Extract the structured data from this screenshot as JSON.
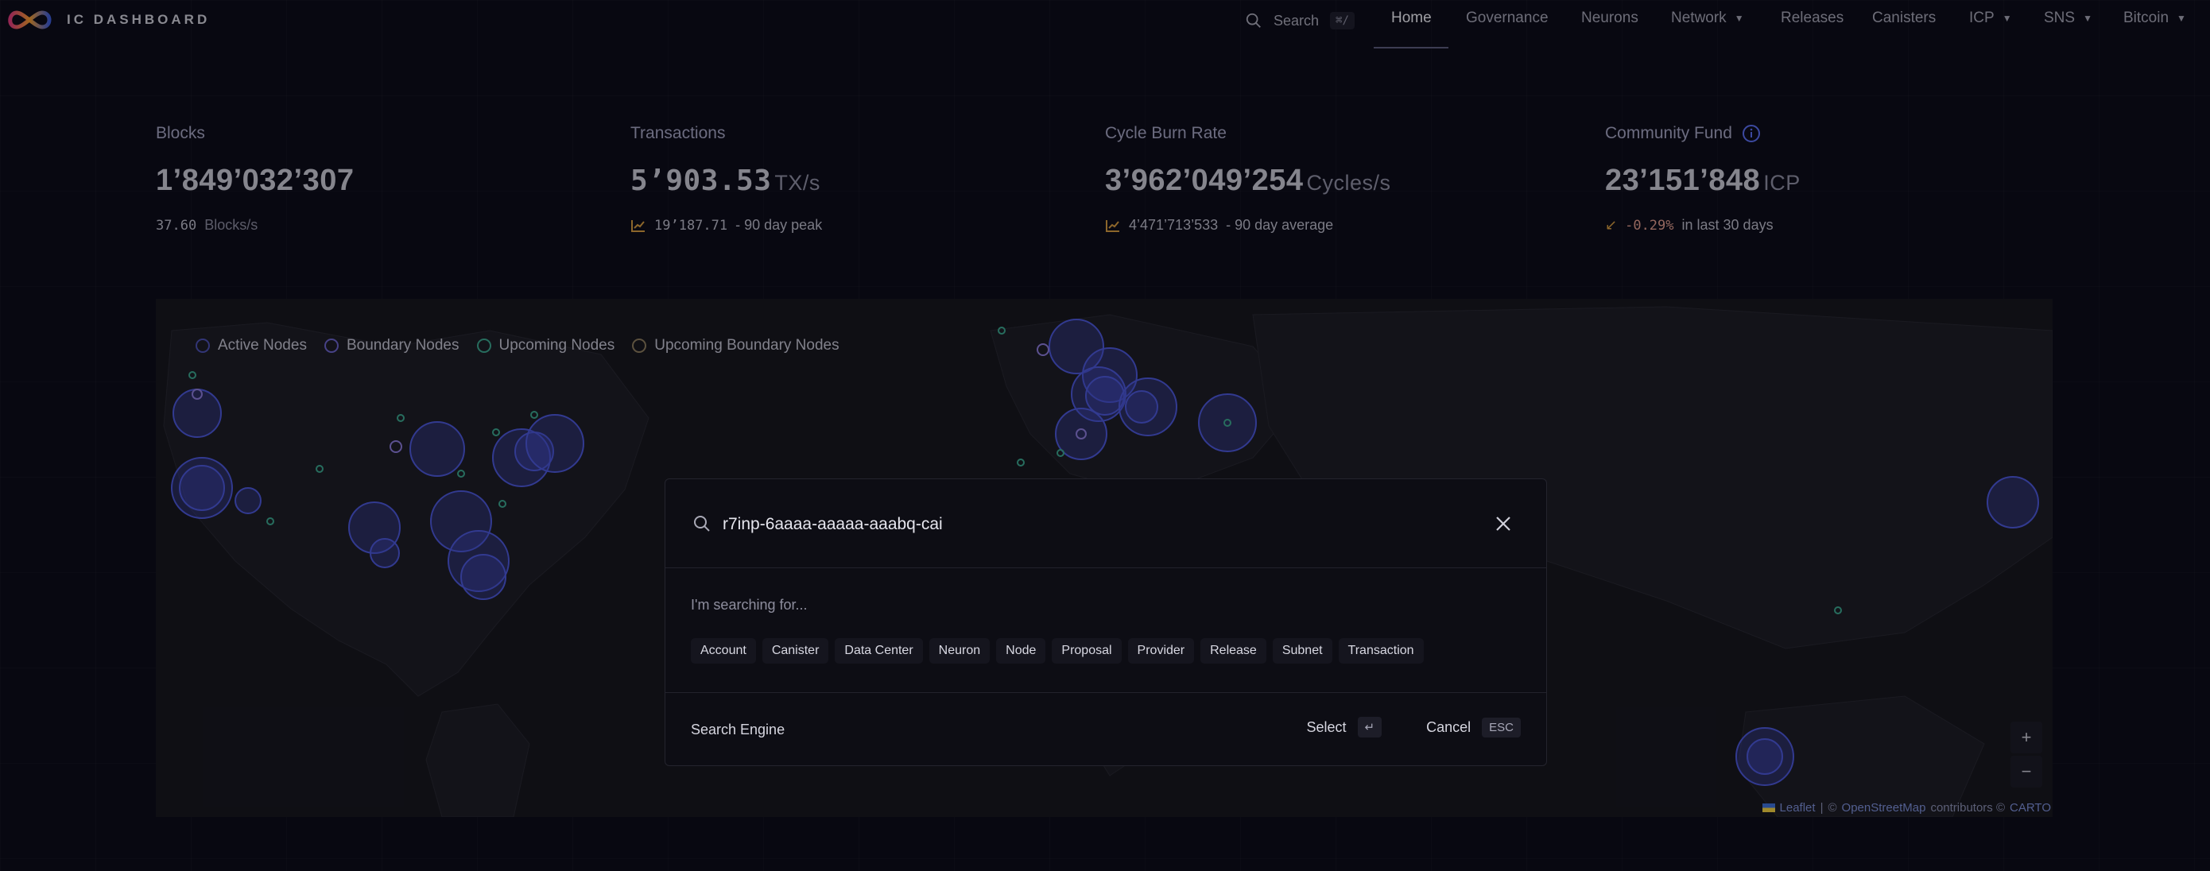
{
  "header": {
    "logo_text": "IC DASHBOARD",
    "search_label": "Search",
    "search_shortcut": "⌘/",
    "nav": [
      {
        "label": "Home",
        "active": true
      },
      {
        "label": "Governance"
      },
      {
        "label": "Neurons"
      },
      {
        "label": "Network",
        "dropdown": true
      },
      {
        "label": "Releases"
      },
      {
        "label": "Canisters"
      },
      {
        "label": "ICP",
        "dropdown": true
      },
      {
        "label": "SNS",
        "dropdown": true
      },
      {
        "label": "Bitcoin",
        "dropdown": true
      }
    ]
  },
  "stats": {
    "blocks": {
      "title": "Blocks",
      "value": "1’849’032’307",
      "sub_value": "37.60",
      "sub_label": "Blocks/s"
    },
    "transactions": {
      "title": "Transactions",
      "value": "5’903.53",
      "unit": "TX/s",
      "sub_value": "19’187.71",
      "sub_label": "- 90 day peak"
    },
    "cycle_burn": {
      "title": "Cycle Burn Rate",
      "value": "3’962’049’254",
      "unit": "Cycles/s",
      "sub_value": "4’471’713’533",
      "sub_label": "- 90 day average"
    },
    "community_fund": {
      "title": "Community Fund",
      "value": "23’151’848",
      "unit": "ICP",
      "sub_value": "-0.29%",
      "sub_label": "in last 30 days"
    }
  },
  "map": {
    "legend": [
      "Active Nodes",
      "Boundary Nodes",
      "Upcoming Nodes",
      "Upcoming Boundary Nodes"
    ],
    "zoom_in": "+",
    "zoom_out": "−",
    "attribution_leaflet": "Leaflet",
    "attribution_sep": "|",
    "attribution_copy": "©",
    "attribution_osm": "OpenStreetMap",
    "attribution_contrib": "contributors ©",
    "attribution_carto": "CARTO",
    "colors": {
      "active": "#4a4fb0",
      "boundary": "#6a63c9",
      "upcoming": "#3aa58a",
      "upcoming_boundary": "#8a7a5a"
    }
  },
  "search_modal": {
    "query": "r7inp-6aaaa-aaaaa-aaabq-cai",
    "hint": "I'm searching for...",
    "chips": [
      "Account",
      "Canister",
      "Data Center",
      "Neuron",
      "Node",
      "Proposal",
      "Provider",
      "Release",
      "Subnet",
      "Transaction"
    ],
    "footer_left": "Search Engine",
    "select_label": "Select",
    "select_key": "↵",
    "cancel_label": "Cancel",
    "cancel_key": "ESC"
  }
}
